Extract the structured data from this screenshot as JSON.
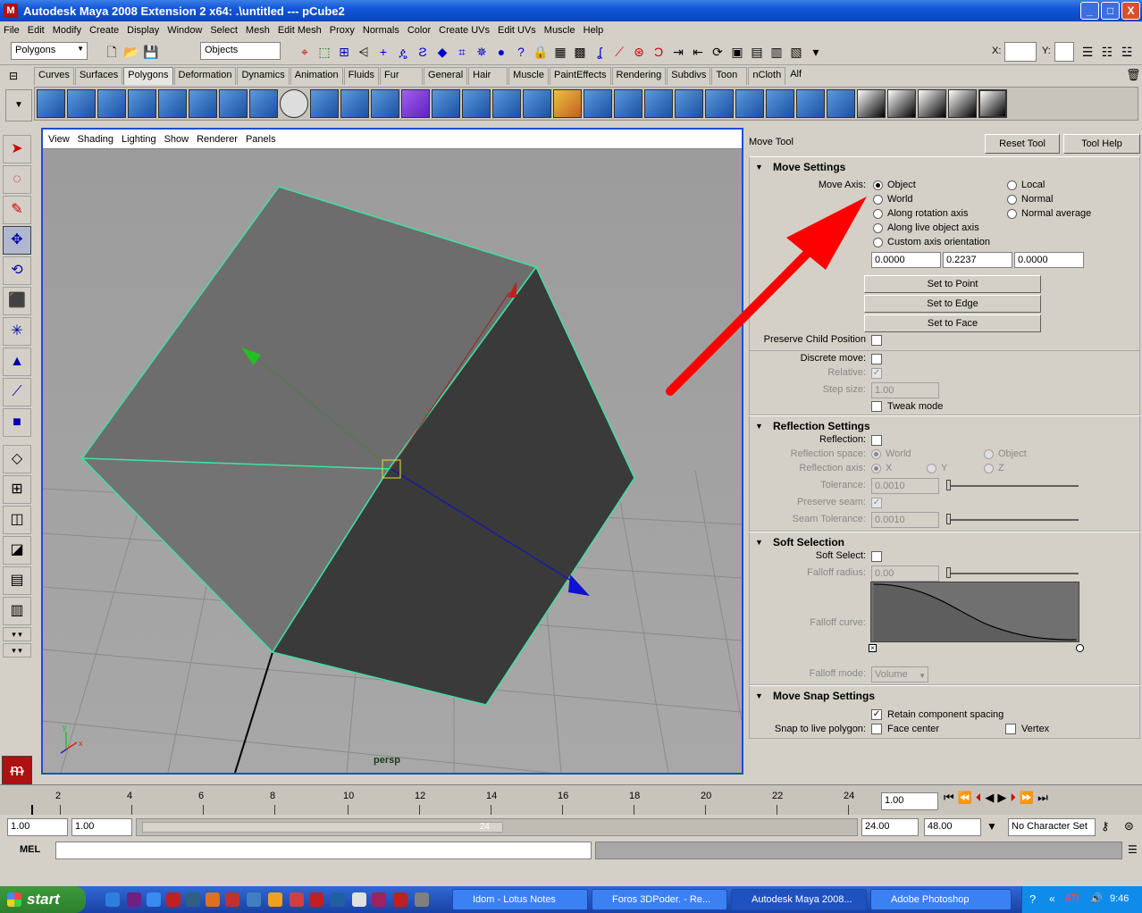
{
  "window": {
    "title": "Autodesk Maya 2008 Extension 2 x64: .\\untitled   ---   pCube2",
    "buttons": {
      "minimize": "_",
      "maximize": "□",
      "close": "X"
    }
  },
  "menubar": [
    "File",
    "Edit",
    "Modify",
    "Create",
    "Display",
    "Window",
    "Select",
    "Mesh",
    "Edit Mesh",
    "Proxy",
    "Normals",
    "Color",
    "Create UVs",
    "Edit UVs",
    "Muscle",
    "Help"
  ],
  "statusline": {
    "menu_set": "Polygons",
    "selection_mode": "Objects",
    "x_label": "X:",
    "y_label": "Y:"
  },
  "shelf_tabs": [
    "Curves",
    "Surfaces",
    "Polygons",
    "Deformation",
    "Dynamics",
    "Animation",
    "Fluids",
    "Fur",
    "General",
    "Hair",
    "Muscle",
    "PaintEffects",
    "Rendering",
    "Subdivs",
    "Toon",
    "nCloth",
    "Alf"
  ],
  "active_shelf_tab": "Polygons",
  "viewport": {
    "menu": [
      "View",
      "Shading",
      "Lighting",
      "Show",
      "Renderer",
      "Panels"
    ],
    "camera_label": "persp",
    "axis_x": "x",
    "axis_y": "y"
  },
  "tool_settings": {
    "tool_name": "Move Tool",
    "reset_button": "Reset Tool",
    "help_button": "Tool Help",
    "move_settings": {
      "title": "Move Settings",
      "move_axis_label": "Move Axis:",
      "axis_options_left": [
        "Object",
        "World",
        "Along rotation axis",
        "Along live object axis",
        "Custom axis orientation"
      ],
      "axis_options_right": [
        "Local",
        "Normal",
        "Normal average"
      ],
      "selected_axis": "Object",
      "values": [
        "0.0000",
        "0.2237",
        "0.0000"
      ],
      "set_to_point": "Set to Point",
      "set_to_edge": "Set to Edge",
      "set_to_face": "Set to Face",
      "preserve_child": "Preserve Child Position",
      "discrete_move": "Discrete move:",
      "relative": "Relative:",
      "step_size": "Step size:",
      "step_value": "1.00",
      "tweak_mode": "Tweak mode"
    },
    "reflection_settings": {
      "title": "Reflection Settings",
      "reflection": "Reflection:",
      "reflection_space": "Reflection space:",
      "space_world": "World",
      "space_object": "Object",
      "reflection_axis": "Reflection axis:",
      "axis_x": "X",
      "axis_y": "Y",
      "axis_z": "Z",
      "tolerance": "Tolerance:",
      "tolerance_value": "0.0010",
      "preserve_seam": "Preserve seam:",
      "seam_tolerance": "Seam Tolerance:",
      "seam_value": "0.0010"
    },
    "soft_selection": {
      "title": "Soft Selection",
      "soft_select": "Soft Select:",
      "falloff_radius": "Falloff radius:",
      "radius_value": "0.00",
      "falloff_curve": "Falloff curve:",
      "falloff_mode": "Falloff mode:",
      "mode_value": "Volume"
    },
    "move_snap": {
      "title": "Move Snap Settings",
      "retain_spacing": "Retain component spacing",
      "snap_label": "Snap to live polygon:",
      "face_center": "Face center",
      "vertex": "Vertex"
    }
  },
  "timeline": {
    "ticks": [
      "2",
      "4",
      "6",
      "8",
      "10",
      "12",
      "14",
      "16",
      "18",
      "20",
      "22",
      "24"
    ],
    "current_time": "1.00"
  },
  "range_slider": {
    "start": "1.00",
    "playback_start": "1.00",
    "range_end_label": "24",
    "playback_end": "24.00",
    "end": "48.00",
    "character_set": "No Character Set"
  },
  "command_line": {
    "label": "MEL"
  },
  "taskbar": {
    "start": "start",
    "items": [
      "Idom - Lotus Notes",
      "Foros 3DPoder. - Re...",
      "Autodesk Maya 2008...",
      "Adobe Photoshop"
    ],
    "clock": "9:46"
  },
  "colors": {
    "titlebar": "#1356d6",
    "viewport_bg": "#a1a1a1",
    "annotation_arrow": "#ff0000",
    "selection_highlight": "#40e0a0"
  }
}
